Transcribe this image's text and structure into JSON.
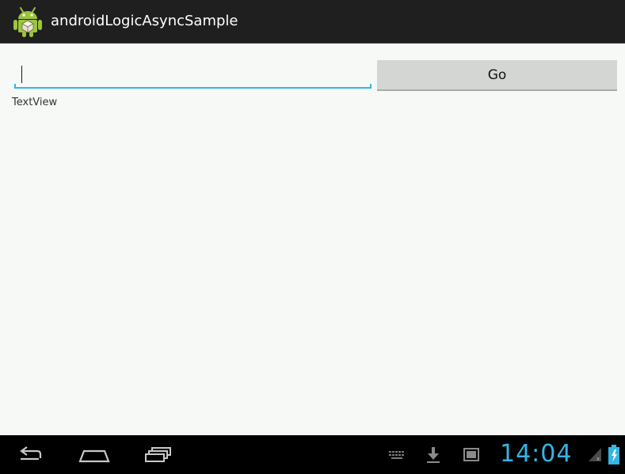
{
  "app": {
    "title": "androidLogicAsyncSample",
    "icon": "android-robot-icon"
  },
  "form": {
    "input_value": "",
    "input_placeholder": "",
    "go_label": "Go",
    "textview_label": "TextView"
  },
  "system_bar": {
    "clock": "14:04",
    "nav_icons": [
      "back-icon",
      "home-icon",
      "recent-apps-icon"
    ],
    "status_icons": [
      "keyboard-icon",
      "download-icon",
      "screenshot-icon",
      "signal-icon",
      "battery-charging-icon"
    ]
  },
  "colors": {
    "action_bar": "#1f1f1f",
    "background": "#f6f9f6",
    "accent": "#33b5e5",
    "button": "#d4d6d3",
    "system_bar": "#000000"
  }
}
